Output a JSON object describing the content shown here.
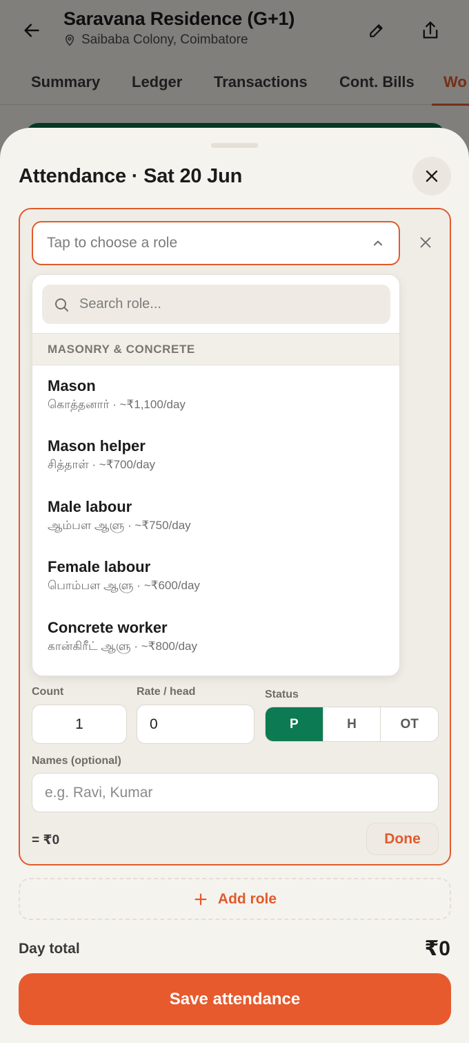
{
  "header": {
    "project_title": "Saravana Residence (G+1)",
    "location": "Saibaba Colony, Coimbatore"
  },
  "tabs": [
    {
      "label": "Summary"
    },
    {
      "label": "Ledger"
    },
    {
      "label": "Transactions"
    },
    {
      "label": "Cont. Bills"
    },
    {
      "label": "Wo"
    }
  ],
  "sheet": {
    "title": "Attendance · Sat 20 Jun",
    "role_placeholder": "Tap to choose a role",
    "search_placeholder": "Search role...",
    "group_header": "MASONRY & CONCRETE",
    "options": [
      {
        "name": "Mason",
        "sub": "கொத்தனார் · ~₹1,100/day"
      },
      {
        "name": "Mason helper",
        "sub": "சித்தாள் · ~₹700/day"
      },
      {
        "name": "Male labour",
        "sub": "ஆம்பள ஆளு · ~₹750/day"
      },
      {
        "name": "Female labour",
        "sub": "பொம்பள ஆளு · ~₹600/day"
      },
      {
        "name": "Concrete worker",
        "sub": "கான்கிரீட் ஆளு · ~₹800/day"
      }
    ],
    "count_label": "Count",
    "count_value": "1",
    "rate_label": "Rate / head",
    "rate_value": "0",
    "status_label": "Status",
    "status_options": [
      "P",
      "H",
      "OT"
    ],
    "status_selected": "P",
    "names_label": "Names (optional)",
    "names_placeholder": "e.g. Ravi, Kumar",
    "subtotal": "= ₹0",
    "done_label": "Done",
    "add_role_label": "Add role",
    "day_total_label": "Day total",
    "day_total_value": "₹0",
    "save_label": "Save attendance"
  },
  "colors": {
    "accent": "#e15a2c",
    "status_active": "#0c7a52"
  }
}
